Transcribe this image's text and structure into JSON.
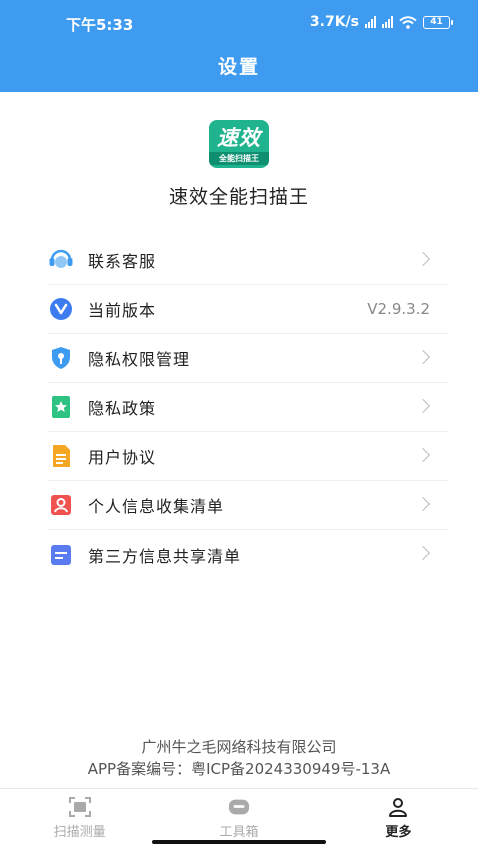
{
  "status_bar": {
    "time": "下午5:33",
    "network_speed": "3.7K/s",
    "battery": "41"
  },
  "header": {
    "title": "设置"
  },
  "app": {
    "logo_main": "速效",
    "logo_sub": "全能扫描王",
    "name": "速效全能扫描王"
  },
  "menu": {
    "items": [
      {
        "label": "联系客服",
        "icon": "customer-service-icon",
        "color": "#3d9cf0"
      },
      {
        "label": "当前版本",
        "icon": "version-icon",
        "value": "V2.9.3.2",
        "color": "#3d7cf0"
      },
      {
        "label": "隐私权限管理",
        "icon": "privacy-shield-icon",
        "color": "#3d9cf0"
      },
      {
        "label": "隐私政策",
        "icon": "privacy-policy-icon",
        "color": "#2ec283"
      },
      {
        "label": "用户协议",
        "icon": "user-agreement-icon",
        "color": "#f5a623"
      },
      {
        "label": "个人信息收集清单",
        "icon": "personal-info-icon",
        "color": "#f0534f"
      },
      {
        "label": "第三方信息共享清单",
        "icon": "third-party-share-icon",
        "color": "#5b7cf0"
      }
    ]
  },
  "footer": {
    "company": "广州牛之毛网络科技有限公司",
    "record": "APP备案编号：粤ICP备2024330949号-13A"
  },
  "tabbar": {
    "tabs": [
      {
        "label": "扫描测量",
        "icon": "scan-icon"
      },
      {
        "label": "工具箱",
        "icon": "toolbox-icon"
      },
      {
        "label": "更多",
        "icon": "person-icon"
      }
    ]
  }
}
